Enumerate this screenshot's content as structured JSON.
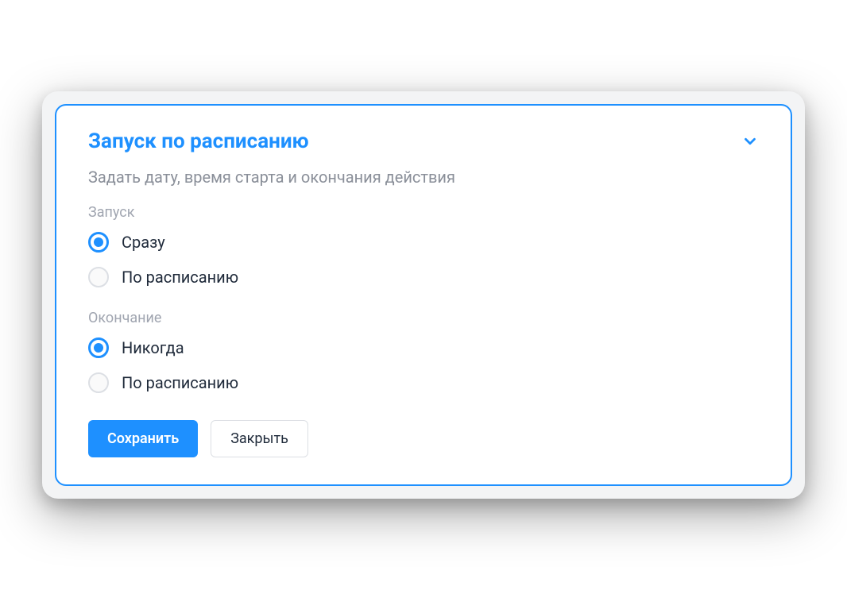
{
  "card": {
    "title": "Запуск по расписанию",
    "subtitle": "Задать дату, время старта и окончания действия"
  },
  "launch": {
    "label": "Запуск",
    "options": [
      {
        "label": "Сразу",
        "checked": true
      },
      {
        "label": "По расписанию",
        "checked": false
      }
    ]
  },
  "end": {
    "label": "Окончание",
    "options": [
      {
        "label": "Никогда",
        "checked": true
      },
      {
        "label": "По расписанию",
        "checked": false
      }
    ]
  },
  "buttons": {
    "save": "Сохранить",
    "close": "Закрыть"
  },
  "colors": {
    "accent": "#1e90ff"
  }
}
